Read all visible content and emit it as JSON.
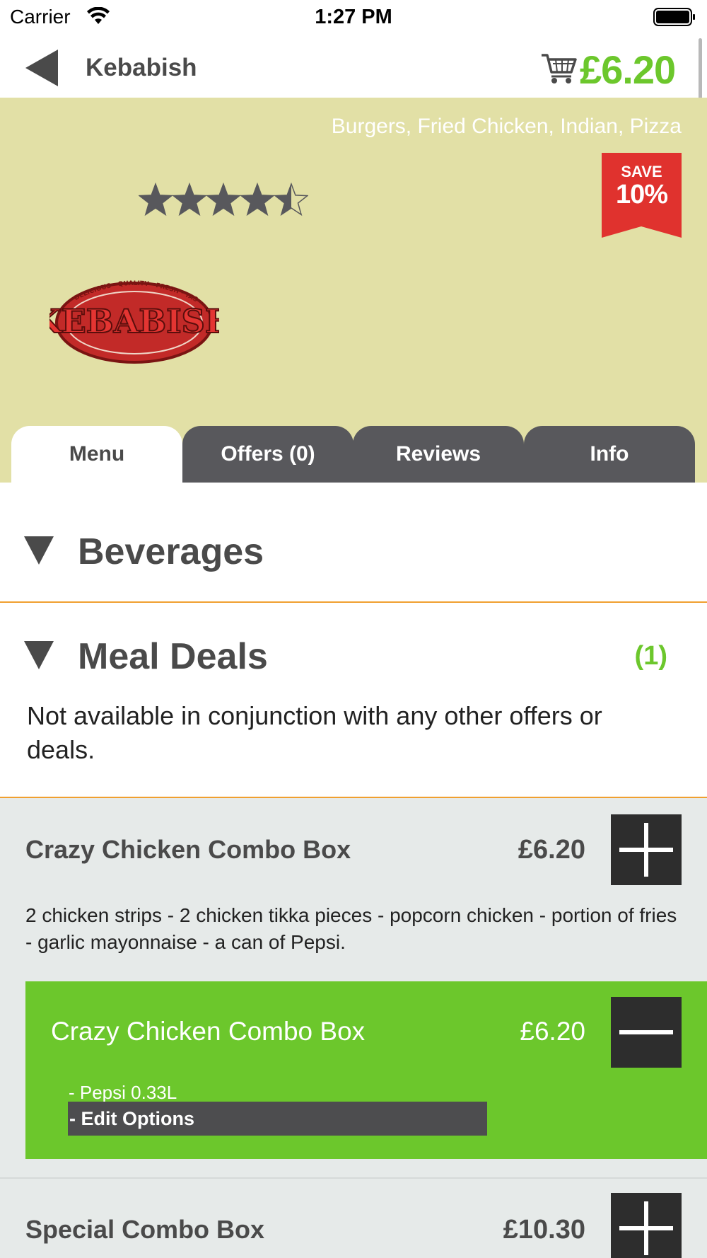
{
  "status_bar": {
    "carrier": "Carrier",
    "time": "1:27 PM"
  },
  "nav": {
    "title": "Kebabish",
    "cart_total": "£6.20",
    "icons": [
      "back-arrow-icon",
      "cart-icon"
    ]
  },
  "restaurant": {
    "cuisines": "Burgers, Fried Chicken, Indian, Pizza",
    "badge": {
      "label": "SAVE",
      "value": "10%"
    },
    "rating": 4.5,
    "rating_max": 5,
    "logo_text": "KEBABISH",
    "logo_tagline": "DELICIOUS · QUALITY · FRESH · TASTY · TEMPTING"
  },
  "tabs": [
    {
      "label": "Menu",
      "active": true
    },
    {
      "label": "Offers (0)",
      "active": false
    },
    {
      "label": "Reviews",
      "active": false
    },
    {
      "label": "Info",
      "active": false
    }
  ],
  "sections": [
    {
      "title": "Beverages",
      "count": ""
    },
    {
      "title": "Meal Deals",
      "count": "(1)",
      "description": "Not available in conjunction with any other offers or deals."
    }
  ],
  "items": [
    {
      "name": "Crazy Chicken Combo Box",
      "price": "£6.20",
      "description": "2 chicken strips - 2 chicken tikka pieces - popcorn chicken - portion of fries - garlic mayonnaise - a can of Pepsi."
    },
    {
      "name": "Special Combo Box",
      "price": "£10.30"
    }
  ],
  "cart_line": {
    "name": "Crazy Chicken Combo Box",
    "price": "£6.20",
    "option": "- Pepsi 0.33L",
    "edit_label": "- Edit Options"
  },
  "colors": {
    "accent_green": "#6cc72c",
    "hero_bg": "#e2e0a6",
    "badge_red": "#e0322e",
    "tab_dark": "#58585c",
    "divider_orange": "#f0a030"
  }
}
